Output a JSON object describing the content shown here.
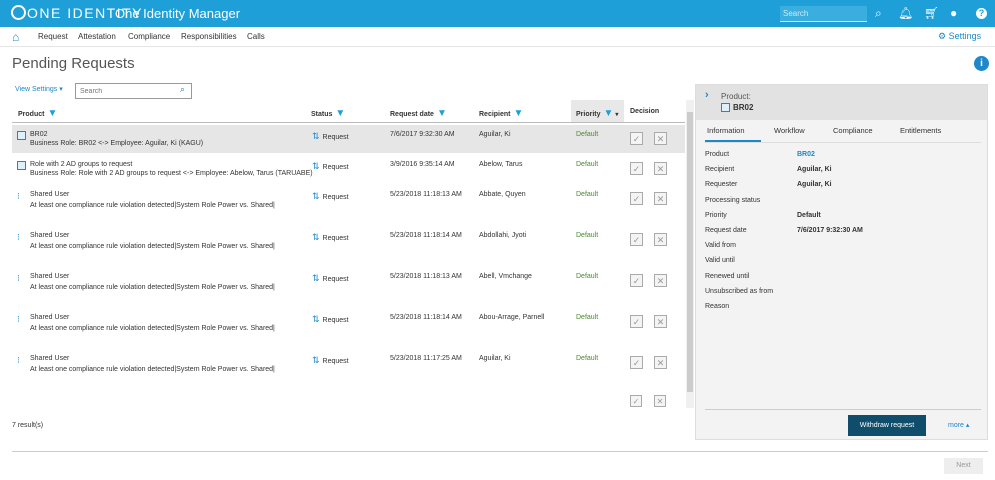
{
  "topbar": {
    "brand": "ONE IDENTITY",
    "app": "One Identity Manager",
    "search_placeholder": "Search"
  },
  "nav": {
    "items": [
      "Request",
      "Attestation",
      "Compliance",
      "Responsibilities",
      "Calls"
    ],
    "settings": "Settings"
  },
  "page": {
    "title": "Pending Requests",
    "view_settings": "View Settings",
    "search_placeholder": "Search"
  },
  "columns": {
    "product": "Product",
    "status": "Status",
    "request_date": "Request date",
    "recipient": "Recipient",
    "priority": "Priority",
    "decision": "Decision"
  },
  "rows": [
    {
      "product": "BR02",
      "sub": "Business Role: BR02 <-> Employee: Aguilar, Ki (KAGU)",
      "status": "Request",
      "date": "7/6/2017 9:32:30 AM",
      "recipient": "Aguilar, Ki",
      "priority": "Default"
    },
    {
      "product": "Role with 2 AD groups to request",
      "sub": "Business Role: Role with 2 AD groups to request <-> Employee: Abelow, Tarus (TARUABE)",
      "status": "Request",
      "date": "3/9/2016 9:35:14 AM",
      "recipient": "Abelow, Tarus",
      "priority": "Default"
    },
    {
      "product": "Shared User",
      "sub": "At least one compliance rule violation detected|System Role Power vs. Shared|",
      "status": "Request",
      "date": "5/23/2018 11:18:13 AM",
      "recipient": "Abbate, Quyen",
      "priority": "Default"
    },
    {
      "product": "Shared User",
      "sub": "At least one compliance rule violation detected|System Role Power vs. Shared|",
      "status": "Request",
      "date": "5/23/2018 11:18:14 AM",
      "recipient": "Abdollahi, Jyoti",
      "priority": "Default"
    },
    {
      "product": "Shared User",
      "sub": "At least one compliance rule violation detected|System Role Power vs. Shared|",
      "status": "Request",
      "date": "5/23/2018 11:18:13 AM",
      "recipient": "Abell, Vmchange",
      "priority": "Default"
    },
    {
      "product": "Shared User",
      "sub": "At least one compliance rule violation detected|System Role Power vs. Shared|",
      "status": "Request",
      "date": "5/23/2018 11:18:14 AM",
      "recipient": "Abou-Arrage, Parnell",
      "priority": "Default"
    },
    {
      "product": "Shared User",
      "sub": "At least one compliance rule violation detected|System Role Power vs. Shared|",
      "status": "Request",
      "date": "5/23/2018 11:17:25 AM",
      "recipient": "Aguilar, Ki",
      "priority": "Default"
    }
  ],
  "results": "7 result(s)",
  "next": "Next",
  "panel": {
    "label": "Product:",
    "name": "BR02",
    "tabs": [
      "Information",
      "Workflow",
      "Compliance",
      "Entitlements"
    ],
    "fields": [
      {
        "label": "Product",
        "value": "BR02"
      },
      {
        "label": "Recipient",
        "value": "Aguilar, Ki"
      },
      {
        "label": "Requester",
        "value": "Aguilar, Ki"
      },
      {
        "label": "Processing status",
        "value": ""
      },
      {
        "label": "Priority",
        "value": "Default"
      },
      {
        "label": "Request date",
        "value": "7/6/2017 9:32:30 AM"
      },
      {
        "label": "Valid from",
        "value": ""
      },
      {
        "label": "Valid until",
        "value": ""
      },
      {
        "label": "Renewed until",
        "value": ""
      },
      {
        "label": "Unsubscribed as from",
        "value": ""
      },
      {
        "label": "Reason",
        "value": ""
      }
    ],
    "withdraw": "Withdraw request",
    "more": "more ▴"
  }
}
